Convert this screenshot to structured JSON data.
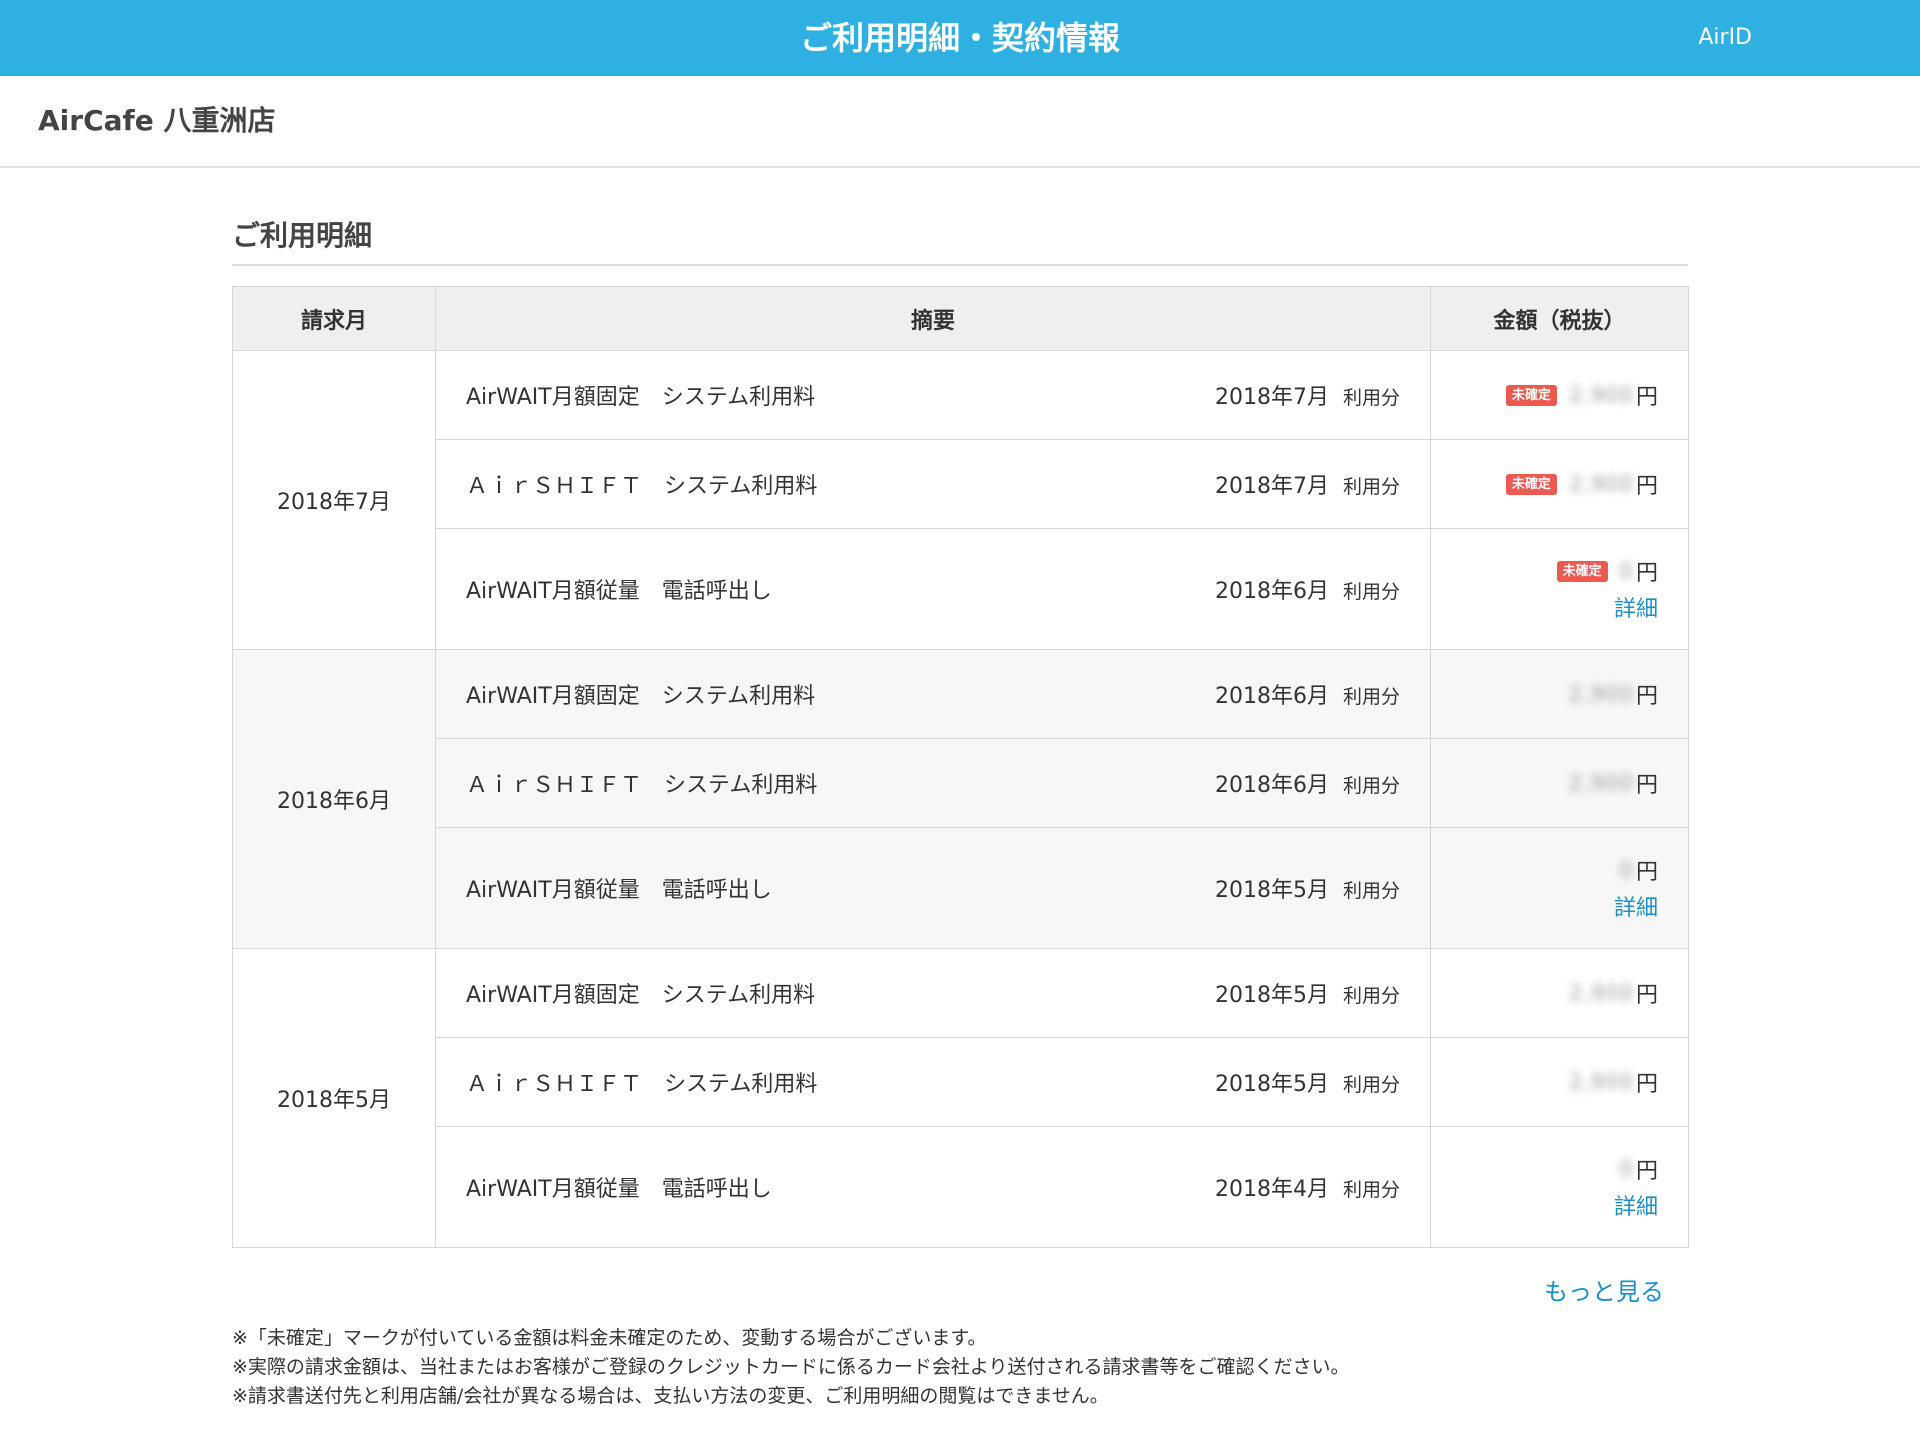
{
  "header": {
    "title": "ご利用明細・契約情報",
    "airid_label": "AirID"
  },
  "store": {
    "name": "AirCafe 八重洲店"
  },
  "section": {
    "title": "ご利用明細"
  },
  "table": {
    "headers": {
      "month": "請求月",
      "description": "摘要",
      "amount": "金額（税抜）"
    },
    "usage_suffix": "利用分",
    "yen": "円",
    "unconfirmed_badge": "未確定",
    "detail_link": "詳細",
    "groups": [
      {
        "month": "2018年7月",
        "rows": [
          {
            "service": "AirWAIT月額固定　システム利用料",
            "period": "2018年7月",
            "amount": "2,900",
            "unconfirmed": true,
            "detail": false
          },
          {
            "service": "ＡｉｒＳＨＩＦＴ　システム利用料",
            "period": "2018年7月",
            "amount": "2,900",
            "unconfirmed": true,
            "detail": false
          },
          {
            "service": "AirWAIT月額従量　電話呼出し",
            "period": "2018年6月",
            "amount": "0",
            "unconfirmed": true,
            "detail": true
          }
        ]
      },
      {
        "month": "2018年6月",
        "rows": [
          {
            "service": "AirWAIT月額固定　システム利用料",
            "period": "2018年6月",
            "amount": "2,900",
            "unconfirmed": false,
            "detail": false
          },
          {
            "service": "ＡｉｒＳＨＩＦＴ　システム利用料",
            "period": "2018年6月",
            "amount": "2,900",
            "unconfirmed": false,
            "detail": false
          },
          {
            "service": "AirWAIT月額従量　電話呼出し",
            "period": "2018年5月",
            "amount": "0",
            "unconfirmed": false,
            "detail": true
          }
        ]
      },
      {
        "month": "2018年5月",
        "rows": [
          {
            "service": "AirWAIT月額固定　システム利用料",
            "period": "2018年5月",
            "amount": "2,900",
            "unconfirmed": false,
            "detail": false
          },
          {
            "service": "ＡｉｒＳＨＩＦＴ　システム利用料",
            "period": "2018年5月",
            "amount": "2,900",
            "unconfirmed": false,
            "detail": false
          },
          {
            "service": "AirWAIT月額従量　電話呼出し",
            "period": "2018年4月",
            "amount": "0",
            "unconfirmed": false,
            "detail": true
          }
        ]
      }
    ]
  },
  "more_label": "もっと見る",
  "notes": [
    "※「未確定」マークが付いている金額は料金未確定のため、変動する場合がございます。",
    "※実際の請求金額は、当社またはお客様がご登録のクレジットカードに係るカード会社より送付される請求書等をご確認ください。",
    "※請求書送付先と利用店舗/会社が異なる場合は、支払い方法の変更、ご利用明細の閲覧はできません。"
  ]
}
